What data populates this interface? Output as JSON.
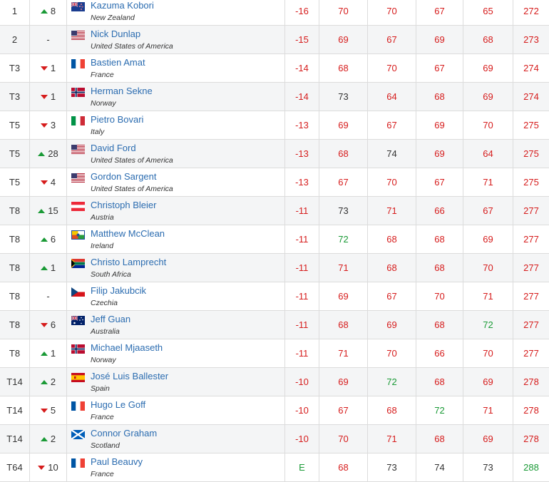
{
  "colors": {
    "under_par": "#d61c1c",
    "over_par": "#333333",
    "birdie_round": "#d61c1c",
    "even_round": "#333333",
    "green_round": "#1a9a36",
    "move_up": "#1a9a36",
    "move_down": "#d61c1c",
    "name_link": "#2b6cb0"
  },
  "rows": [
    {
      "pos": "1",
      "move": "8",
      "dir": "up",
      "name": "Kazuma Kobori",
      "country": "New Zealand",
      "flag": "nz",
      "par": "-16",
      "par_c": "red",
      "r": [
        "70",
        "70",
        "67",
        "65"
      ],
      "rc": [
        "red",
        "red",
        "red",
        "red"
      ],
      "tot": "272",
      "tot_c": "red"
    },
    {
      "pos": "2",
      "move": "-",
      "dir": "none",
      "name": "Nick Dunlap",
      "country": "United States of America",
      "flag": "us",
      "par": "-15",
      "par_c": "red",
      "r": [
        "69",
        "67",
        "69",
        "68"
      ],
      "rc": [
        "red",
        "red",
        "red",
        "red"
      ],
      "tot": "273",
      "tot_c": "red"
    },
    {
      "pos": "T3",
      "move": "1",
      "dir": "down",
      "name": "Bastien Amat",
      "country": "France",
      "flag": "fr",
      "par": "-14",
      "par_c": "red",
      "r": [
        "68",
        "70",
        "67",
        "69"
      ],
      "rc": [
        "red",
        "red",
        "red",
        "red"
      ],
      "tot": "274",
      "tot_c": "red"
    },
    {
      "pos": "T3",
      "move": "1",
      "dir": "down",
      "name": "Herman Sekne",
      "country": "Norway",
      "flag": "no",
      "par": "-14",
      "par_c": "red",
      "r": [
        "73",
        "64",
        "68",
        "69"
      ],
      "rc": [
        "black",
        "red",
        "red",
        "red"
      ],
      "tot": "274",
      "tot_c": "red"
    },
    {
      "pos": "T5",
      "move": "3",
      "dir": "down",
      "name": "Pietro Bovari",
      "country": "Italy",
      "flag": "it",
      "par": "-13",
      "par_c": "red",
      "r": [
        "69",
        "67",
        "69",
        "70"
      ],
      "rc": [
        "red",
        "red",
        "red",
        "red"
      ],
      "tot": "275",
      "tot_c": "red"
    },
    {
      "pos": "T5",
      "move": "28",
      "dir": "up",
      "name": "David Ford",
      "country": "United States of America",
      "flag": "us",
      "par": "-13",
      "par_c": "red",
      "r": [
        "68",
        "74",
        "69",
        "64"
      ],
      "rc": [
        "red",
        "black",
        "red",
        "red"
      ],
      "tot": "275",
      "tot_c": "red"
    },
    {
      "pos": "T5",
      "move": "4",
      "dir": "down",
      "name": "Gordon Sargent",
      "country": "United States of America",
      "flag": "us",
      "par": "-13",
      "par_c": "red",
      "r": [
        "67",
        "70",
        "67",
        "71"
      ],
      "rc": [
        "red",
        "red",
        "red",
        "red"
      ],
      "tot": "275",
      "tot_c": "red"
    },
    {
      "pos": "T8",
      "move": "15",
      "dir": "up",
      "name": "Christoph Bleier",
      "country": "Austria",
      "flag": "at",
      "par": "-11",
      "par_c": "red",
      "r": [
        "73",
        "71",
        "66",
        "67"
      ],
      "rc": [
        "black",
        "red",
        "red",
        "red"
      ],
      "tot": "277",
      "tot_c": "red"
    },
    {
      "pos": "T8",
      "move": "6",
      "dir": "up",
      "name": "Matthew McClean",
      "country": "Ireland",
      "flag": "ie",
      "par": "-11",
      "par_c": "red",
      "r": [
        "72",
        "68",
        "68",
        "69"
      ],
      "rc": [
        "green",
        "red",
        "red",
        "red"
      ],
      "tot": "277",
      "tot_c": "red"
    },
    {
      "pos": "T8",
      "move": "1",
      "dir": "up",
      "name": "Christo Lamprecht",
      "country": "South Africa",
      "flag": "za",
      "par": "-11",
      "par_c": "red",
      "r": [
        "71",
        "68",
        "68",
        "70"
      ],
      "rc": [
        "red",
        "red",
        "red",
        "red"
      ],
      "tot": "277",
      "tot_c": "red"
    },
    {
      "pos": "T8",
      "move": "-",
      "dir": "none",
      "name": "Filip Jakubcik",
      "country": "Czechia",
      "flag": "cz",
      "par": "-11",
      "par_c": "red",
      "r": [
        "69",
        "67",
        "70",
        "71"
      ],
      "rc": [
        "red",
        "red",
        "red",
        "red"
      ],
      "tot": "277",
      "tot_c": "red"
    },
    {
      "pos": "T8",
      "move": "6",
      "dir": "down",
      "name": "Jeff Guan",
      "country": "Australia",
      "flag": "au",
      "par": "-11",
      "par_c": "red",
      "r": [
        "68",
        "69",
        "68",
        "72"
      ],
      "rc": [
        "red",
        "red",
        "red",
        "green"
      ],
      "tot": "277",
      "tot_c": "red"
    },
    {
      "pos": "T8",
      "move": "1",
      "dir": "up",
      "name": "Michael Mjaaseth",
      "country": "Norway",
      "flag": "no",
      "par": "-11",
      "par_c": "red",
      "r": [
        "71",
        "70",
        "66",
        "70"
      ],
      "rc": [
        "red",
        "red",
        "red",
        "red"
      ],
      "tot": "277",
      "tot_c": "red"
    },
    {
      "pos": "T14",
      "move": "2",
      "dir": "up",
      "name": "José Luis Ballester",
      "country": "Spain",
      "flag": "es",
      "par": "-10",
      "par_c": "red",
      "r": [
        "69",
        "72",
        "68",
        "69"
      ],
      "rc": [
        "red",
        "green",
        "red",
        "red"
      ],
      "tot": "278",
      "tot_c": "red"
    },
    {
      "pos": "T14",
      "move": "5",
      "dir": "down",
      "name": "Hugo Le Goff",
      "country": "France",
      "flag": "fr",
      "par": "-10",
      "par_c": "red",
      "r": [
        "67",
        "68",
        "72",
        "71"
      ],
      "rc": [
        "red",
        "red",
        "green",
        "red"
      ],
      "tot": "278",
      "tot_c": "red"
    },
    {
      "pos": "T14",
      "move": "2",
      "dir": "up",
      "name": "Connor Graham",
      "country": "Scotland",
      "flag": "sc",
      "par": "-10",
      "par_c": "red",
      "r": [
        "70",
        "71",
        "68",
        "69"
      ],
      "rc": [
        "red",
        "red",
        "red",
        "red"
      ],
      "tot": "278",
      "tot_c": "red"
    },
    {
      "pos": "T64",
      "move": "10",
      "dir": "down",
      "name": "Paul Beauvy",
      "country": "France",
      "flag": "fr",
      "par": "E",
      "par_c": "green",
      "r": [
        "68",
        "73",
        "74",
        "73"
      ],
      "rc": [
        "red",
        "black",
        "black",
        "black"
      ],
      "tot": "288",
      "tot_c": "green"
    }
  ]
}
